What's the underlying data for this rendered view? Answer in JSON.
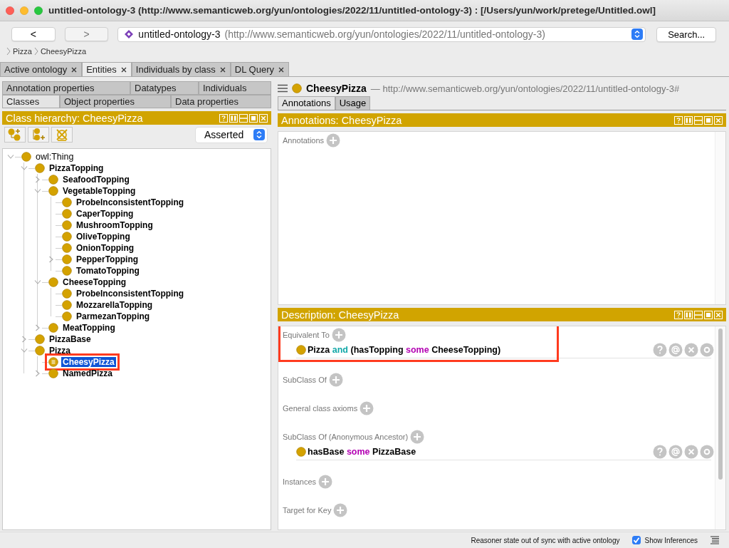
{
  "window": {
    "title": "untitled-ontology-3 (http://www.semanticweb.org/yun/ontologies/2022/11/untitled-ontology-3)  : [/Users/yun/work/pretege/Untitled.owl]"
  },
  "toolbar": {
    "back": "<",
    "forward": ">",
    "ontology_name": "untitled-ontology-3",
    "ontology_iri": "(http://www.semanticweb.org/yun/ontologies/2022/11/untitled-ontology-3)",
    "search": "Search..."
  },
  "breadcrumb": [
    "Pizza",
    "CheesyPizza"
  ],
  "workspace_tabs": [
    {
      "label": "Active ontology",
      "selected": false
    },
    {
      "label": "Entities",
      "selected": true
    },
    {
      "label": "Individuals by class",
      "selected": false
    },
    {
      "label": "DL Query",
      "selected": false
    }
  ],
  "entity_tabs": [
    [
      {
        "label": "Annotation properties",
        "selected": false
      },
      {
        "label": "Datatypes",
        "selected": false
      },
      {
        "label": "Individuals",
        "selected": false
      }
    ],
    [
      {
        "label": "Classes",
        "selected": true
      },
      {
        "label": "Object properties",
        "selected": false
      },
      {
        "label": "Data properties",
        "selected": false
      }
    ]
  ],
  "class_hierarchy": {
    "title": "Class hierarchy: CheesyPizza",
    "mode": "Asserted",
    "tree": [
      {
        "label": "owl:Thing",
        "expanded": true,
        "selected": false,
        "highlighted": false,
        "defined": false,
        "children": [
          {
            "label": "PizzaTopping",
            "expanded": true,
            "selected": false,
            "highlighted": false,
            "defined": false,
            "children": [
              {
                "label": "SeafoodTopping",
                "expanded": false,
                "selected": false,
                "highlighted": false,
                "defined": false
              },
              {
                "label": "VegetableTopping",
                "expanded": true,
                "selected": false,
                "highlighted": false,
                "defined": false,
                "children": [
                  {
                    "label": "ProbeInconsistentTopping",
                    "selected": false,
                    "highlighted": false,
                    "defined": false
                  },
                  {
                    "label": "CaperTopping",
                    "selected": false,
                    "highlighted": false,
                    "defined": false
                  },
                  {
                    "label": "MushroomTopping",
                    "selected": false,
                    "highlighted": false,
                    "defined": false
                  },
                  {
                    "label": "OliveTopping",
                    "selected": false,
                    "highlighted": false,
                    "defined": false
                  },
                  {
                    "label": "OnionTopping",
                    "selected": false,
                    "highlighted": false,
                    "defined": false
                  },
                  {
                    "label": "PepperTopping",
                    "expanded": false,
                    "selected": false,
                    "highlighted": false,
                    "defined": false
                  },
                  {
                    "label": "TomatoTopping",
                    "selected": false,
                    "highlighted": false,
                    "defined": false
                  }
                ]
              },
              {
                "label": "CheeseTopping",
                "expanded": true,
                "selected": false,
                "highlighted": false,
                "defined": false,
                "children": [
                  {
                    "label": "ProbeInconsistentTopping",
                    "selected": false,
                    "highlighted": false,
                    "defined": false
                  },
                  {
                    "label": "MozzarellaTopping",
                    "selected": false,
                    "highlighted": false,
                    "defined": false
                  },
                  {
                    "label": "ParmezanTopping",
                    "selected": false,
                    "highlighted": false,
                    "defined": false
                  }
                ]
              },
              {
                "label": "MeatTopping",
                "expanded": false,
                "selected": false,
                "highlighted": false,
                "defined": false
              }
            ]
          },
          {
            "label": "PizzaBase",
            "expanded": false,
            "selected": false,
            "highlighted": false,
            "defined": false
          },
          {
            "label": "Pizza",
            "expanded": true,
            "selected": false,
            "highlighted": false,
            "defined": false,
            "children": [
              {
                "label": "CheesyPizza",
                "selected": true,
                "highlighted": true,
                "defined": true
              },
              {
                "label": "NamedPizza",
                "expanded": false,
                "selected": false,
                "highlighted": false,
                "defined": false
              }
            ]
          }
        ]
      }
    ]
  },
  "entity_header": {
    "name": "CheesyPizza",
    "iri": "— http://www.semanticweb.org/yun/ontologies/2022/11/untitled-ontology-3#"
  },
  "view_tabs": [
    {
      "label": "Annotations",
      "selected": true
    },
    {
      "label": "Usage",
      "selected": false
    }
  ],
  "annotations": {
    "title": "Annotations: CheesyPizza",
    "sections": [
      {
        "label": "Annotations",
        "highlighted": false
      }
    ]
  },
  "description": {
    "title": "Description: CheesyPizza",
    "sections": [
      {
        "label": "Equivalent To",
        "highlighted": true,
        "axioms": [
          [
            {
              "text": "Pizza",
              "kind": "name"
            },
            {
              "text": "and",
              "kind": "logical"
            },
            {
              "text": "(hasTopping",
              "kind": "name"
            },
            {
              "text": "some",
              "kind": "restriction"
            },
            {
              "text": "CheeseTopping)",
              "kind": "name"
            }
          ]
        ]
      },
      {
        "label": "SubClass Of",
        "highlighted": false
      },
      {
        "label": "General class axioms",
        "highlighted": false
      },
      {
        "label": "SubClass Of (Anonymous Ancestor)",
        "highlighted": false,
        "axioms": [
          [
            {
              "text": "hasBase",
              "kind": "name"
            },
            {
              "text": "some",
              "kind": "restriction"
            },
            {
              "text": "PizzaBase",
              "kind": "name"
            }
          ]
        ]
      },
      {
        "label": "Instances",
        "highlighted": false
      },
      {
        "label": "Target for Key",
        "highlighted": false
      }
    ]
  },
  "status_bar": {
    "message": "Reasoner state out of sync with active ontology",
    "show_inferences": {
      "label": "Show Inferences",
      "checked": true
    }
  }
}
